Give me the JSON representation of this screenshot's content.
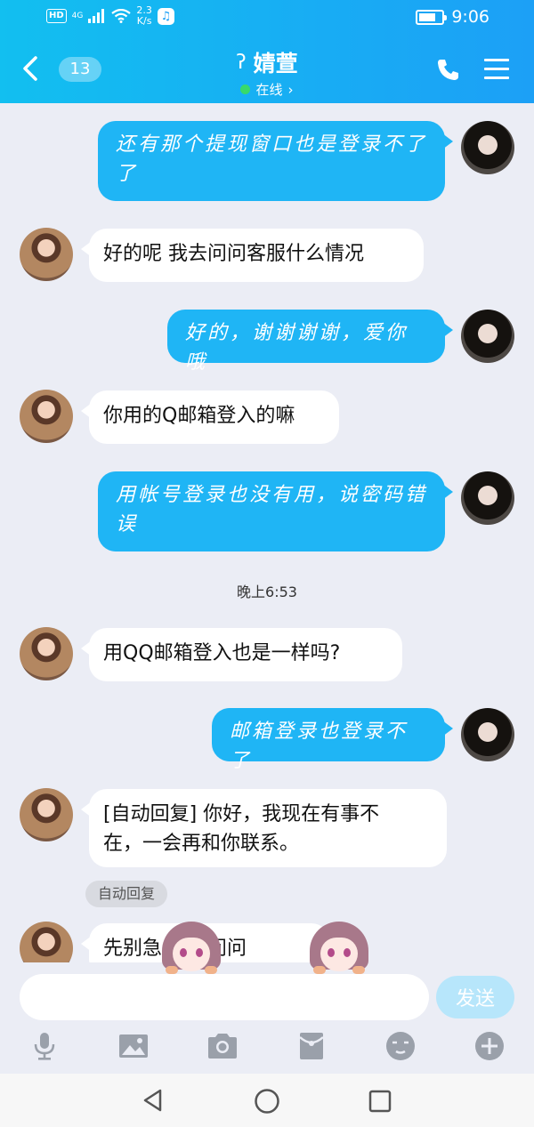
{
  "status_bar": {
    "hd": "HD",
    "network": "4G",
    "speed_value": "2.3",
    "speed_unit": "K/s",
    "time": "9:06",
    "battery_level": 0.75
  },
  "header": {
    "unread_count": "13",
    "contact_name": "婧萱",
    "status": "在线",
    "status_arrow": "›",
    "ear_glyph": "ʔ"
  },
  "messages": [
    {
      "from": "me",
      "lines": [
        "还有那个提现窗口也是登录不了",
        "了"
      ]
    },
    {
      "from": "her",
      "text": "好的呢  我去问问客服什么情况"
    },
    {
      "from": "me",
      "text": "好的，谢谢谢谢，爱你哦"
    },
    {
      "from": "her",
      "text": "你用的Q邮箱登入的嘛"
    },
    {
      "from": "me",
      "lines": [
        "用帐号登录也没有用，说密码错",
        "误"
      ]
    },
    {
      "from": "her",
      "text": "用QQ邮箱登入也是一样吗?"
    },
    {
      "from": "me",
      "text": "邮箱登录也登录不了"
    },
    {
      "from": "her",
      "lines": [
        "[自动回复] 你好，我现在有事不",
        "在，一会再和你联系。"
      ]
    },
    {
      "from": "her",
      "text": "先别急    帮你问问"
    }
  ],
  "timestamp": "晚上6:53",
  "auto_reply_tag": "自动回复",
  "input": {
    "placeholder": "",
    "value": ""
  },
  "send_label": "发送",
  "toolbar": [
    "microphone-icon",
    "image-icon",
    "camera-icon",
    "red-packet-icon",
    "emoji-icon",
    "plus-icon"
  ],
  "colors": {
    "header_start": "#12bff0",
    "header_end": "#1ca0f6",
    "outgoing_bubble": "#1fb5f5",
    "send_disabled": "#b7e6fb"
  }
}
